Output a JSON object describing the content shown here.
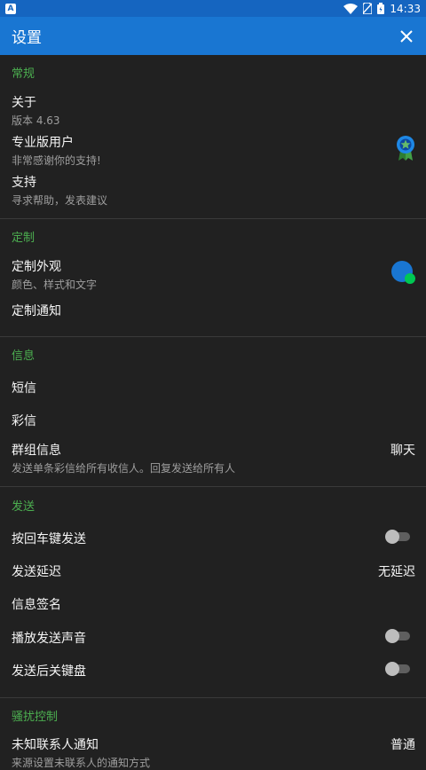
{
  "statusbar": {
    "time": "14:33",
    "app_badge": "A"
  },
  "appbar": {
    "title": "设置"
  },
  "sections": {
    "general": {
      "title": "常规",
      "about": {
        "title": "关于",
        "subtitle": "版本 4.63"
      },
      "pro": {
        "title": "专业版用户",
        "subtitle": "非常感谢你的支持!"
      },
      "support": {
        "title": "支持",
        "subtitle": "寻求帮助，发表建议"
      }
    },
    "customize": {
      "title": "定制",
      "appearance": {
        "title": "定制外观",
        "subtitle": "颜色、样式和文字"
      },
      "notifications": {
        "title": "定制通知"
      }
    },
    "messages": {
      "title": "信息",
      "sms": {
        "title": "短信"
      },
      "mms": {
        "title": "彩信"
      },
      "group": {
        "title": "群组信息",
        "subtitle": "发送单条彩信给所有收信人。回复发送给所有人",
        "value": "聊天"
      }
    },
    "sending": {
      "title": "发送",
      "enter_send": {
        "title": "按回车键发送",
        "enabled": false
      },
      "delay": {
        "title": "发送延迟",
        "value": "无延迟"
      },
      "signature": {
        "title": "信息签名"
      },
      "sound": {
        "title": "播放发送声音",
        "enabled": false
      },
      "hide_keyboard": {
        "title": "发送后关键盘",
        "enabled": false
      }
    },
    "spam": {
      "title": "骚扰控制",
      "unknown": {
        "title": "未知联系人通知",
        "subtitle": "来源设置未联系人的通知方式",
        "value": "普通"
      }
    }
  },
  "colors": {
    "accent": "#4caf50",
    "primary": "#1976d2",
    "status": "#1565c0",
    "background": "#212121"
  }
}
